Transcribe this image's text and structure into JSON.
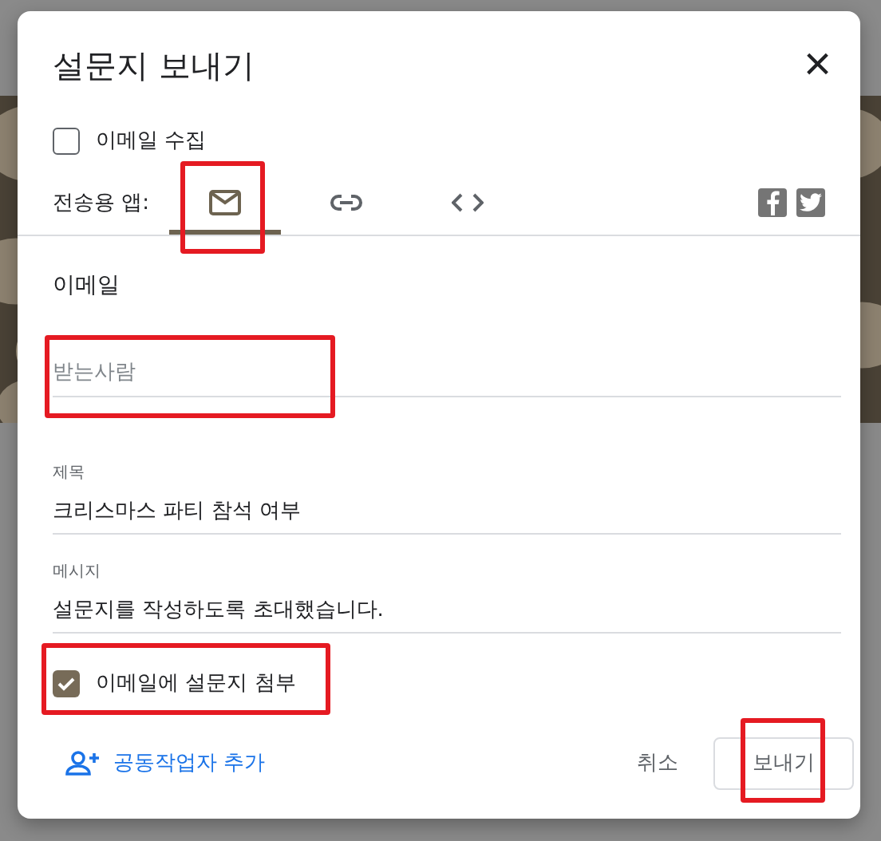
{
  "dialog": {
    "title": "설문지 보내기",
    "close": "×"
  },
  "collect_email": {
    "label": "이메일 수집",
    "checked": false
  },
  "send_via": {
    "label": "전송용 앱:",
    "tabs": [
      {
        "kind": "email",
        "selected": true
      },
      {
        "kind": "link",
        "selected": false
      },
      {
        "kind": "embed",
        "selected": false
      }
    ]
  },
  "section_title": "이메일",
  "fields": [
    {
      "kind": "recipient",
      "placeholder": "받는사람"
    },
    {
      "kind": "subject",
      "label": "제목",
      "value": "크리스마스 파티 참석 여부"
    },
    {
      "kind": "message",
      "label": "메시지",
      "value": "설문지를 작성하도록 초대했습니다."
    }
  ],
  "attach_form": {
    "label": "이메일에 설문지 첨부",
    "checked": true
  },
  "footer": {
    "add_collaborators": "공동작업자 추가",
    "cancel": "취소",
    "send": "보내기"
  },
  "highlight_frames": [
    {
      "kind": "email_tab"
    },
    {
      "kind": "recipient"
    },
    {
      "kind": "attach"
    },
    {
      "kind": "send"
    }
  ]
}
